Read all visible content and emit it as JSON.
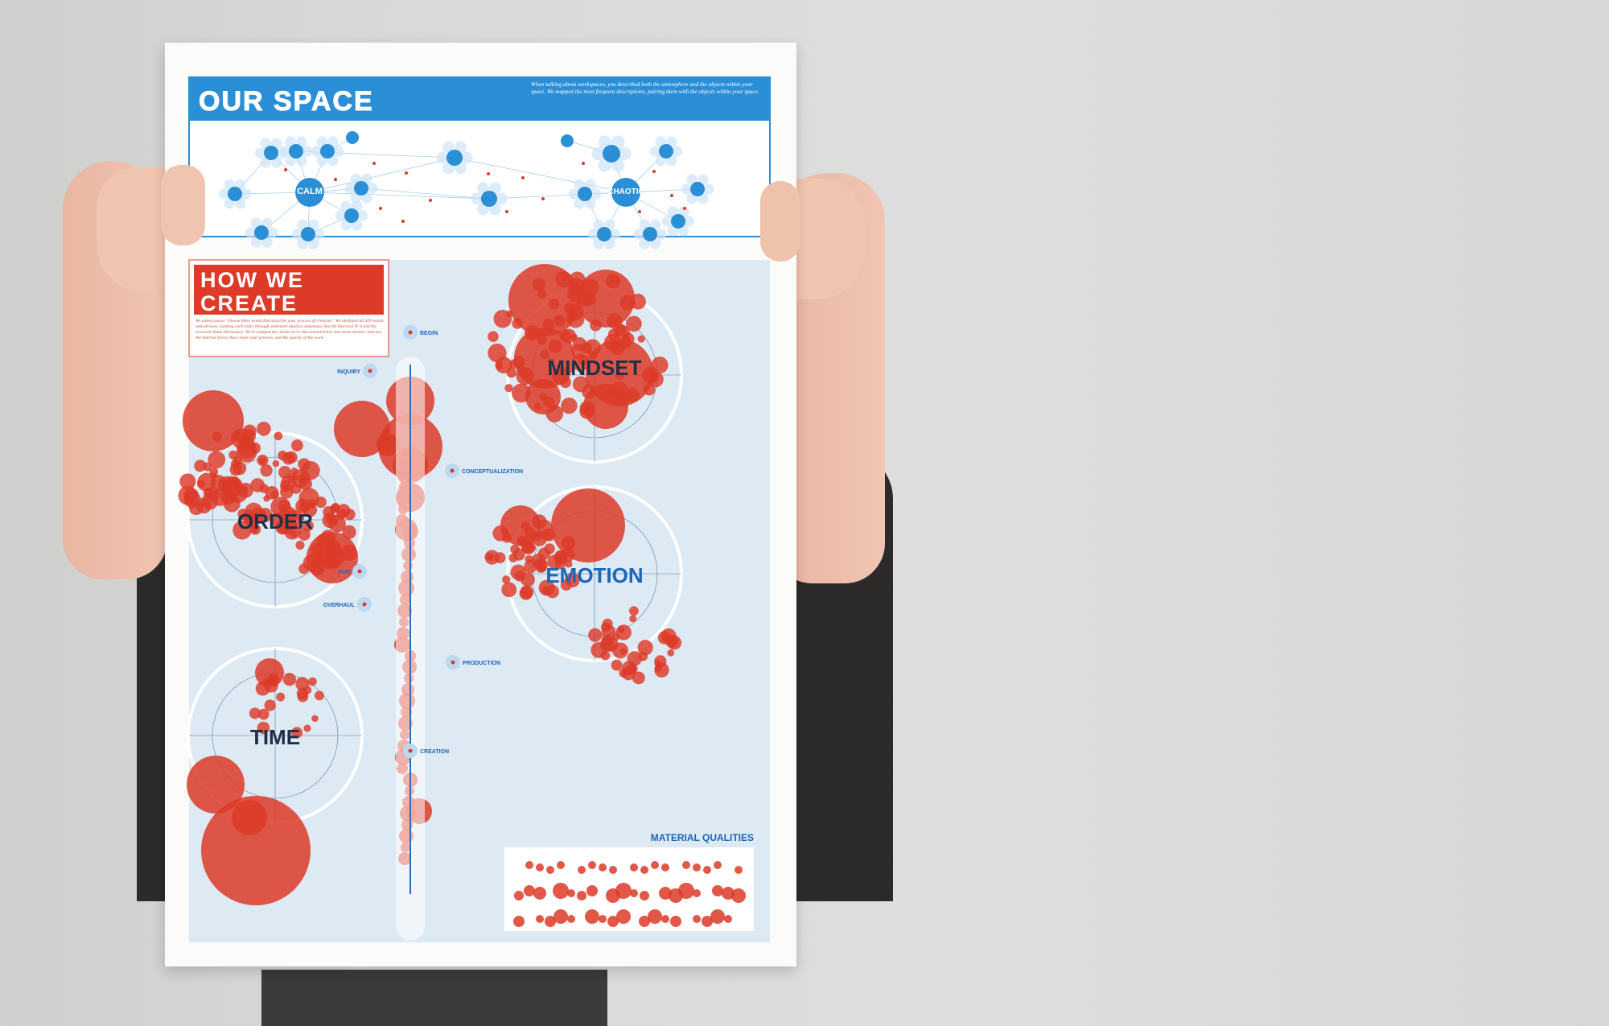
{
  "poster": {
    "our_space": {
      "title": "OUR SPACE",
      "intro": "When talking about workspaces, you described both the atmosphere and the objects within your space. We mapped the most frequent descriptions, pairing them with the objects within your space.",
      "hubs": [
        {
          "label": "CALM"
        },
        {
          "label": "CHAOTIC"
        }
      ]
    },
    "how_we_create": {
      "title_line1": "HOW WE",
      "title_line2": "CREATE",
      "intro": "We asked you to \"choose three words that describe your process of creation.\" We analyzed all 309 words and phrases, running each entry through sentiment analysis databases like the Harvard IV-4 and the Lasswell Value Dictionary. We've mapped the trends we've discovered below into three themes: process, the internal forces that create your process, and the quality of the work.",
      "themes": [
        "ORDER",
        "MINDSET",
        "EMOTION",
        "TIME"
      ],
      "process_stages": [
        "BEGIN",
        "INQUIRY",
        "CONCEPTUALIZATION",
        "FUN",
        "OVERHAUL",
        "PRODUCTION",
        "CREATION"
      ],
      "material_title": "MATERIAL QUALITIES"
    }
  },
  "colors": {
    "blue": "#2a8fd6",
    "red": "#dd3b28",
    "panel": "#dde9f3",
    "navy": "#1f2f48"
  }
}
